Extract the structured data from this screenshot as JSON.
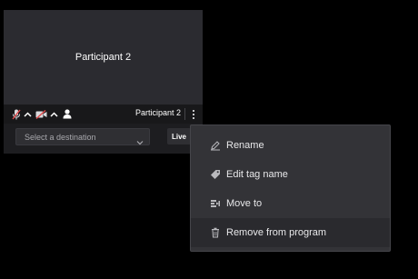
{
  "card": {
    "video_name": "Participant 2",
    "control_name": "Participant 2"
  },
  "controls": {
    "icons": [
      "mic-muted-icon",
      "chevron-up-icon",
      "camera-off-icon",
      "chevron-up-icon",
      "person-icon",
      "kebab-menu-icon"
    ]
  },
  "destination": {
    "placeholder": "Select a destination"
  },
  "live_button": {
    "label": "Live"
  },
  "menu": {
    "items": [
      {
        "label": "Rename",
        "icon": "pencil-icon"
      },
      {
        "label": "Edit tag name",
        "icon": "tag-icon"
      },
      {
        "label": "Move to",
        "icon": "move-to-icon"
      },
      {
        "label": "Remove from program",
        "icon": "trash-icon"
      }
    ]
  },
  "colors": {
    "background": "#000000",
    "card": "#1d1d20",
    "video": "#2b2b30",
    "menu": "#333337",
    "muted_red": "#e0484a"
  }
}
